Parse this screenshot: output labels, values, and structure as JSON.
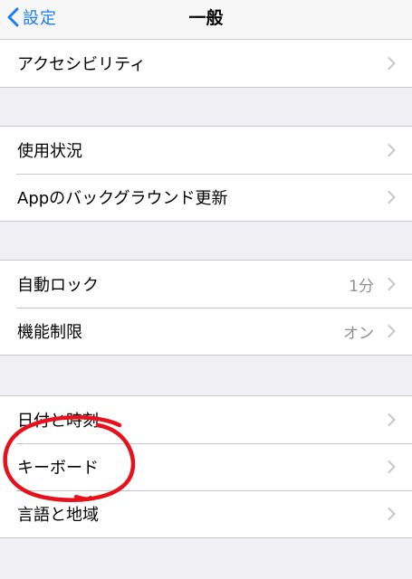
{
  "nav": {
    "back_label": "設定",
    "title": "一般"
  },
  "groups": [
    {
      "rows": [
        {
          "label": "アクセシビリティ",
          "value": ""
        }
      ]
    },
    {
      "rows": [
        {
          "label": "使用状況",
          "value": ""
        },
        {
          "label": "Appのバックグラウンド更新",
          "value": ""
        }
      ]
    },
    {
      "rows": [
        {
          "label": "自動ロック",
          "value": "1分"
        },
        {
          "label": "機能制限",
          "value": "オン"
        }
      ]
    },
    {
      "rows": [
        {
          "label": "日付と時刻",
          "value": ""
        },
        {
          "label": "キーボード",
          "value": ""
        },
        {
          "label": "言語と地域",
          "value": ""
        }
      ]
    }
  ],
  "colors": {
    "accent": "#1a7cf4",
    "background": "#efeff4",
    "annotation": "#e8101a"
  },
  "icons": {
    "back": "chevron-left-icon",
    "disclosure": "chevron-right-icon"
  }
}
